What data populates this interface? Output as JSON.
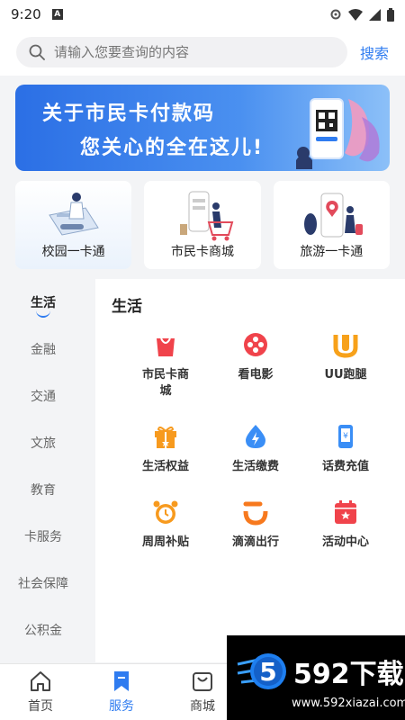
{
  "status_bar": {
    "time": "9:20"
  },
  "search": {
    "placeholder": "请输入您要查询的内容",
    "button_label": "搜索"
  },
  "banner": {
    "line1": "关于市民卡付款码",
    "line2": "您关心的全在这儿!"
  },
  "feature_cards": [
    {
      "label": "校园一卡通"
    },
    {
      "label": "市民卡商城"
    },
    {
      "label": "旅游一卡通"
    }
  ],
  "sidebar": {
    "items": [
      {
        "label": "生活",
        "active": true
      },
      {
        "label": "金融"
      },
      {
        "label": "交通"
      },
      {
        "label": "文旅"
      },
      {
        "label": "教育"
      },
      {
        "label": "卡服务"
      },
      {
        "label": "社会保障"
      },
      {
        "label": "公积金"
      }
    ]
  },
  "main": {
    "title": "生活",
    "services": [
      {
        "label": "市民卡商城",
        "icon": "shopping-bag-icon",
        "color": "#f0434b"
      },
      {
        "label": "看电影",
        "icon": "film-reel-icon",
        "color": "#f0434b"
      },
      {
        "label": "UU跑腿",
        "icon": "uu-logo-icon",
        "color": "#f7a11a"
      },
      {
        "label": "生活权益",
        "icon": "gift-icon",
        "color": "#f79a1e"
      },
      {
        "label": "生活缴费",
        "icon": "droplet-bolt-icon",
        "color": "#3a8ef6"
      },
      {
        "label": "话费充值",
        "icon": "phone-yen-icon",
        "color": "#3a8ef6"
      },
      {
        "label": "周周补贴",
        "icon": "alarm-clock-icon",
        "color": "#f79a1e"
      },
      {
        "label": "滴滴出行",
        "icon": "didi-logo-icon",
        "color": "#f7791e"
      },
      {
        "label": "活动中心",
        "icon": "calendar-star-icon",
        "color": "#f0434b"
      }
    ]
  },
  "bottom_nav": {
    "items": [
      {
        "label": "首页",
        "icon": "home-icon"
      },
      {
        "label": "服务",
        "icon": "bookmark-icon",
        "active": true
      },
      {
        "label": "商城",
        "icon": "shopping-bag-outline-icon"
      }
    ]
  },
  "watermark": {
    "title": "592下载",
    "url": "www.592xiazai.com",
    "logo_digit": "5"
  },
  "colors": {
    "accent": "#2f7cf0",
    "page_bg": "#f3f4f6"
  }
}
